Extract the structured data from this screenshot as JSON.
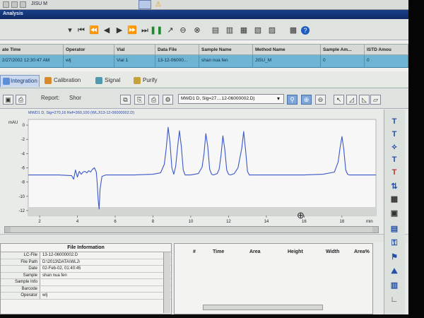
{
  "app": {
    "top_label": "JISU M",
    "title": "Analysis"
  },
  "sample_table": {
    "columns": [
      "ate Time",
      "Operator",
      "Vial",
      "Data File",
      "Sample Name",
      "Method Name",
      "Sample Am...",
      "ISTD Amou"
    ],
    "row": [
      "2/27/2002 12:30:47 AM",
      "wlj",
      "Vial 1",
      "13-12-06000...",
      "shan nua fen",
      "JISU_M",
      "0",
      "0"
    ]
  },
  "tabs": [
    {
      "label": "Integration",
      "active": true
    },
    {
      "label": "Calibration",
      "active": false
    },
    {
      "label": "Signal",
      "active": false
    },
    {
      "label": "Purify",
      "active": false
    }
  ],
  "toolbar2": {
    "report_label": "Report:",
    "report_value": "Shor",
    "signal_select": "MWD1 D, Sig=27....12-06000002.D)"
  },
  "chart_data": {
    "type": "line",
    "title": "MWD1 D, Sig=270,16 Ref=360,100 (WLJ\\13-12-06000002.D)",
    "ylabel": "mAU",
    "xlabel": "min",
    "x_ticks": [
      2,
      4,
      6,
      8,
      10,
      12,
      14,
      16,
      18
    ],
    "y_ticks": [
      0,
      -2,
      -4,
      -6,
      -8,
      -10,
      -12
    ],
    "xlim": [
      1.4,
      19.8
    ],
    "ylim": [
      -12.7,
      0.8
    ],
    "series": [
      {
        "color": "#3b57c9",
        "x": [
          1.4,
          2.0,
          3.0,
          3.7,
          3.8,
          3.9,
          4.0,
          4.1,
          4.2,
          4.3,
          4.4,
          4.5,
          4.6,
          4.7,
          4.8,
          4.9,
          5.0,
          5.05,
          5.1,
          5.15,
          5.2,
          5.3,
          5.5,
          6.0,
          7.0,
          8.0,
          8.4,
          8.6,
          8.7,
          8.8,
          8.9,
          9.0,
          9.1,
          9.2,
          9.3,
          9.4,
          9.5,
          9.6,
          9.7,
          9.8,
          10.0,
          10.4,
          10.6,
          10.7,
          10.8,
          10.9,
          11.0,
          11.1,
          11.2,
          11.4,
          11.5,
          11.6,
          11.7,
          11.8,
          11.9,
          12.0,
          12.1,
          12.3,
          12.5,
          12.7,
          12.8,
          12.9,
          13.0,
          13.1,
          13.2,
          13.4,
          13.6,
          14.0,
          15.0,
          16.0,
          17.0,
          17.6,
          17.8,
          17.9,
          18.0,
          18.1,
          18.2,
          18.3,
          18.4,
          18.6,
          19.0,
          19.8
        ],
        "y": [
          -7.0,
          -7.0,
          -7.0,
          -7.1,
          -7.6,
          -6.3,
          -7.3,
          -6.5,
          -6.9,
          -6.6,
          -6.5,
          -6.7,
          -6.4,
          -6.6,
          -6.2,
          -6.0,
          -6.6,
          -8.2,
          -10.5,
          -11.8,
          -9.0,
          -7.2,
          -7.0,
          -7.0,
          -7.0,
          -6.9,
          -6.7,
          -5.5,
          -3.3,
          -0.3,
          -2.4,
          -6.0,
          -6.9,
          -5.8,
          -3.2,
          -0.8,
          -3.0,
          -6.3,
          -7.0,
          -7.0,
          -7.0,
          -6.8,
          -5.9,
          -4.0,
          -1.2,
          -3.0,
          -6.2,
          -6.9,
          -7.0,
          -6.8,
          -6.2,
          -4.3,
          -1.5,
          -3.4,
          -6.3,
          -6.9,
          -7.0,
          -6.8,
          -6.0,
          -3.2,
          -0.9,
          -3.5,
          -6.5,
          -7.0,
          -7.0,
          -7.0,
          -7.0,
          -7.0,
          -7.0,
          -7.0,
          -6.9,
          -6.6,
          -5.2,
          -3.2,
          -1.6,
          -3.4,
          -6.3,
          -6.9,
          -7.0,
          -7.0,
          -7.0,
          -7.0
        ]
      }
    ]
  },
  "file_info": {
    "header": "File Information",
    "rows": [
      {
        "key": "LC-File",
        "value": "13-12-06000002.D"
      },
      {
        "key": "File Path",
        "value": "D:\\2013\\DATA\\WLJ\\"
      },
      {
        "key": "Date",
        "value": "02-Feb-02, 01:40:45"
      },
      {
        "key": "Sample",
        "value": "shan nua fen"
      },
      {
        "key": "Sample Info",
        "value": ""
      },
      {
        "key": "Barcode",
        "value": ""
      },
      {
        "key": "Operator",
        "value": "wlj"
      }
    ]
  },
  "peak_table": {
    "columns": [
      "#",
      "Time",
      "Area",
      "Height",
      "Width",
      "Area%"
    ]
  },
  "colors": {
    "title_bar": "#0f2a66",
    "selected_row": "#6fb4d2",
    "trace": "#3b57c9"
  }
}
